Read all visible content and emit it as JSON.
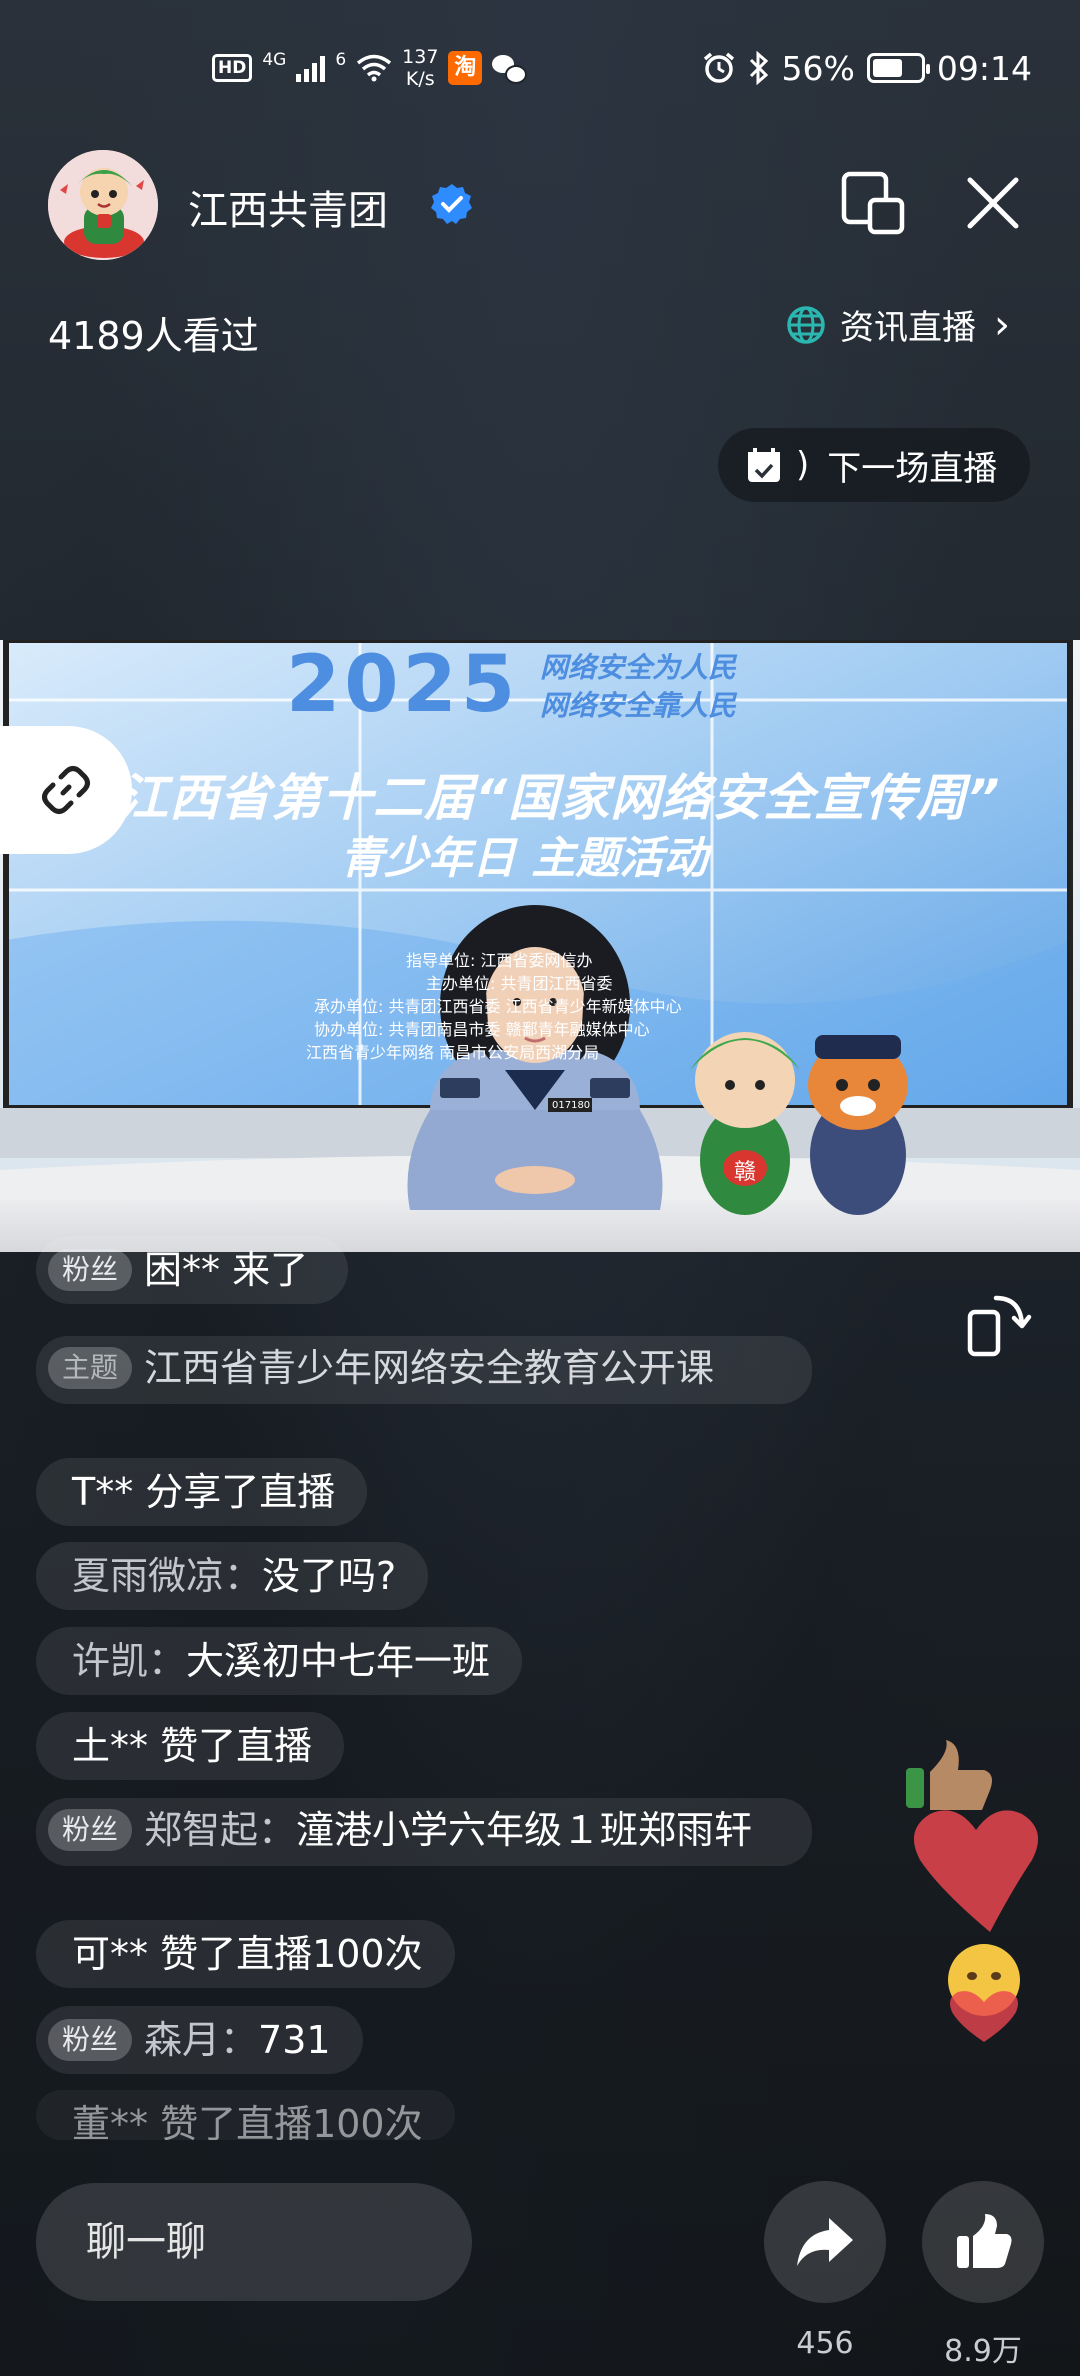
{
  "status_bar": {
    "hd": "HD",
    "network": "4G",
    "network2": "6",
    "speed_value": "137",
    "speed_unit": "K/s",
    "taobao": "淘",
    "battery": "56%",
    "time": "09:14"
  },
  "header": {
    "channel_name": "江西共青团",
    "viewers": "4189人看过",
    "category": "资讯直播",
    "category_arrow": "›",
    "next_live": "下一场直播",
    "next_live_prefix": ")"
  },
  "video": {
    "banner_year": "2025",
    "slogan_line1": "网络安全为人民",
    "slogan_line2": "网络安全靠人民",
    "title_line1": "江西省第十二届“国家网络安全宣传周”",
    "title_line2": "青少年日 主题活动",
    "credit_line1": "指导单位: 江西省委网信办",
    "credit_line2": "主办单位: 共青团江西省委",
    "credit_line3": "承办单位: 共青团江西省委 江西省青少年新媒体中心",
    "credit_line4": "协办单位: 共青团南昌市委 赣鄱青年融媒体中心",
    "credit_line5": "江西省青少年网络 南昌市公安局西湖分局",
    "badge_number": "017180",
    "mascot_char": "赣"
  },
  "comments": [
    {
      "badge": "粉丝",
      "user": "",
      "text": "困** 来了"
    },
    {
      "badge": "主题",
      "user": "",
      "text": "江西省青少年网络安全教育公开课"
    },
    {
      "badge": "",
      "user": "",
      "text": "T** 分享了直播"
    },
    {
      "badge": "",
      "user": "夏雨微凉：",
      "text": "没了吗?"
    },
    {
      "badge": "",
      "user": "许凯：",
      "text": "大溪初中七年一班"
    },
    {
      "badge": "",
      "user": "",
      "text": "土** 赞了直播"
    },
    {
      "badge": "粉丝",
      "user": "郑智起：",
      "text": "潼港小学六年级１班郑雨轩"
    },
    {
      "badge": "",
      "user": "",
      "text": "可** 赞了直播100次"
    },
    {
      "badge": "粉丝",
      "user": "森月：",
      "text": "731"
    },
    {
      "badge": "",
      "user": "",
      "text": "董** 赞了直播100次"
    }
  ],
  "bottom": {
    "chat_placeholder": "聊一聊",
    "share_count": "456",
    "like_count": "8.9万"
  },
  "colors": {
    "verified_blue": "#2f8cff",
    "globe_teal": "#2bb7b0",
    "taobao_orange": "#ff6a00",
    "heart_red": "#e8454f"
  },
  "icons": {
    "link": "link-icon",
    "rotate": "rotate-screen-icon",
    "share": "share-icon",
    "like": "thumbs-up-icon",
    "close": "close-icon",
    "float": "floating-window-icon",
    "calendar": "calendar-icon",
    "globe": "globe-icon"
  }
}
